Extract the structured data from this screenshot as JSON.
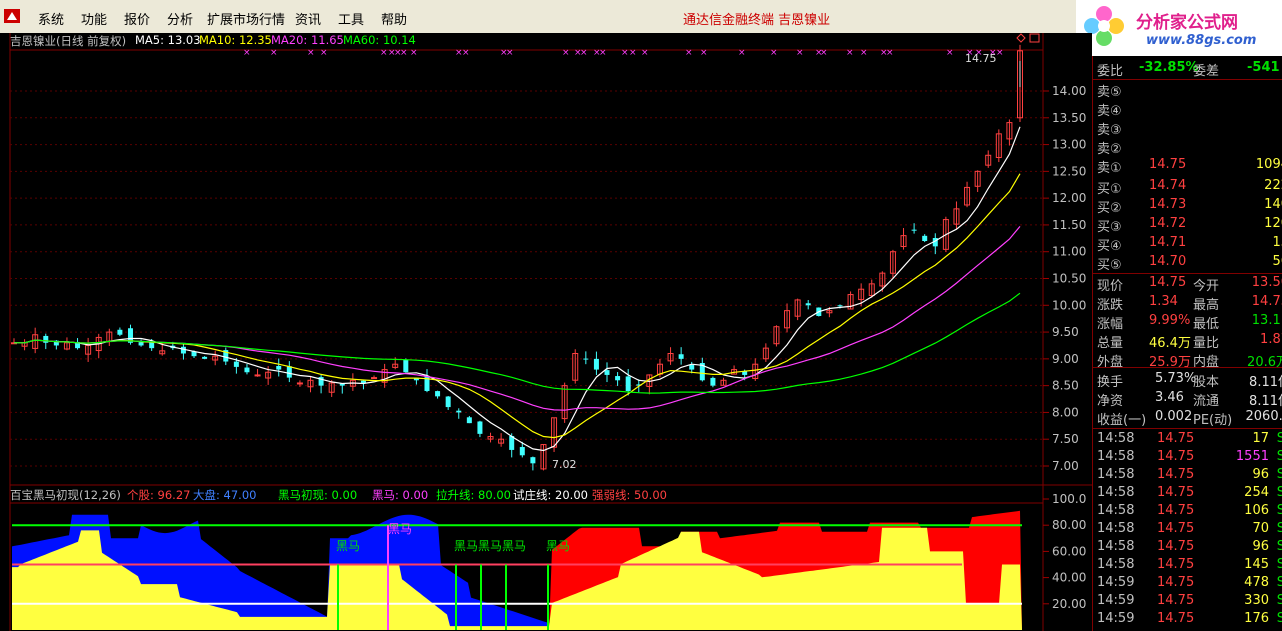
{
  "menubar": {
    "items": [
      "系统",
      "功能",
      "报价",
      "分析",
      "扩展市场行情",
      "资讯",
      "工具",
      "帮助"
    ],
    "brand": "通达信金融终端  吉恩镍业"
  },
  "ad": {
    "title": "分析家公式网",
    "url": "www.88gs.com"
  },
  "main_panel": {
    "title": "吉恩镍业(日线 前复权)",
    "ma": [
      {
        "label": "MA5: 13.03",
        "color": "#ffffff"
      },
      {
        "label": "MA10: 12.35",
        "color": "#ffff00"
      },
      {
        "label": "MA20: 11.65",
        "color": "#ff40ff"
      },
      {
        "label": "MA60: 10.14",
        "color": "#00ff00"
      }
    ],
    "high_label": "14.75",
    "low_label": "7.02",
    "y_ticks": [
      "14.00",
      "13.50",
      "13.00",
      "12.50",
      "12.00",
      "11.50",
      "11.00",
      "10.50",
      "10.00",
      "9.50",
      "9.00",
      "8.50",
      "8.00",
      "7.50",
      "7.00"
    ]
  },
  "sub_panel": {
    "title": "百宝黑马初现(12,26)",
    "params": [
      {
        "label": "个股: 96.27",
        "color": "#ff4040"
      },
      {
        "label": "大盘: 47.00",
        "color": "#4080ff"
      },
      {
        "label": "黑马初现: 0.00",
        "color": "#00ff00"
      },
      {
        "label": "黑马: 0.00",
        "color": "#ff40ff"
      },
      {
        "label": "拉升线: 80.00",
        "color": "#00ff00"
      },
      {
        "label": "试庄线: 20.00",
        "color": "#ffffff"
      },
      {
        "label": "强弱线: 50.00",
        "color": "#ff4040"
      }
    ],
    "y_ticks": [
      "100.0",
      "80.00",
      "60.00",
      "40.00",
      "20.00"
    ],
    "signal_labels": [
      "黑马",
      "黑马",
      "黑马黑马黑马",
      "黑马"
    ]
  },
  "chart_data": {
    "type": "candlestick",
    "title": "吉恩镍业(日线 前复权)",
    "ylim": [
      6.8,
      15.0
    ],
    "ma": {
      "MA5": 13.03,
      "MA10": 12.35,
      "MA20": 11.65,
      "MA60": 10.14
    },
    "high": 14.75,
    "low": 7.02,
    "closes": [
      9.3,
      9.3,
      9.45,
      9.3,
      9.25,
      9.3,
      9.2,
      9.25,
      9.4,
      9.5,
      9.45,
      9.3,
      9.25,
      9.2,
      9.15,
      9.2,
      9.1,
      9.05,
      9.0,
      9.05,
      8.95,
      8.85,
      8.75,
      8.7,
      8.75,
      8.8,
      8.65,
      8.55,
      8.6,
      8.5,
      8.55,
      8.5,
      8.6,
      8.55,
      8.65,
      8.8,
      8.9,
      8.75,
      8.6,
      8.4,
      8.3,
      8.1,
      8.0,
      7.8,
      7.6,
      7.55,
      7.5,
      7.3,
      7.2,
      7.05,
      7.4,
      7.9,
      8.5,
      9.1,
      9.0,
      8.8,
      8.7,
      8.6,
      8.4,
      8.5,
      8.7,
      8.9,
      9.1,
      9.0,
      8.8,
      8.6,
      8.5,
      8.6,
      8.8,
      8.7,
      8.9,
      9.2,
      9.6,
      9.9,
      10.1,
      10.0,
      9.8,
      9.9,
      10.0,
      10.2,
      10.3,
      10.4,
      10.6,
      11.0,
      11.3,
      11.4,
      11.2,
      11.1,
      11.6,
      11.8,
      12.2,
      12.5,
      12.8,
      13.2,
      13.41,
      14.75
    ]
  }
}
